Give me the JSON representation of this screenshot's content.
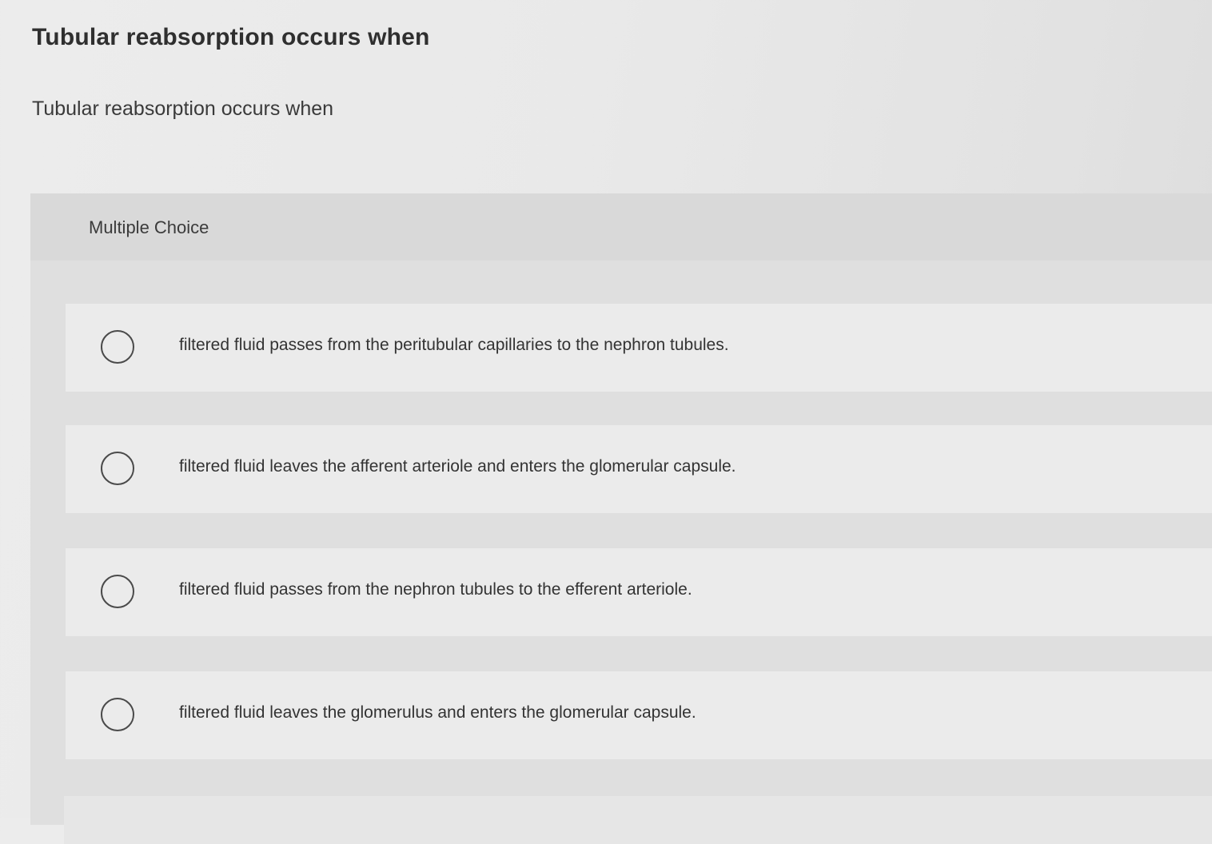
{
  "question": {
    "title": "Tubular reabsorption occurs when",
    "prompt": "Tubular reabsorption occurs when"
  },
  "multiple_choice": {
    "label": "Multiple Choice",
    "options": [
      {
        "text": "filtered fluid passes from the peritubular capillaries to the nephron tubules.",
        "selected": false
      },
      {
        "text": "filtered fluid leaves the afferent arteriole and enters the glomerular capsule.",
        "selected": false
      },
      {
        "text": "filtered fluid passes from the nephron tubules to the efferent arteriole.",
        "selected": false
      },
      {
        "text": "filtered fluid leaves the glomerulus and enters the glomerular capsule.",
        "selected": false
      }
    ]
  }
}
